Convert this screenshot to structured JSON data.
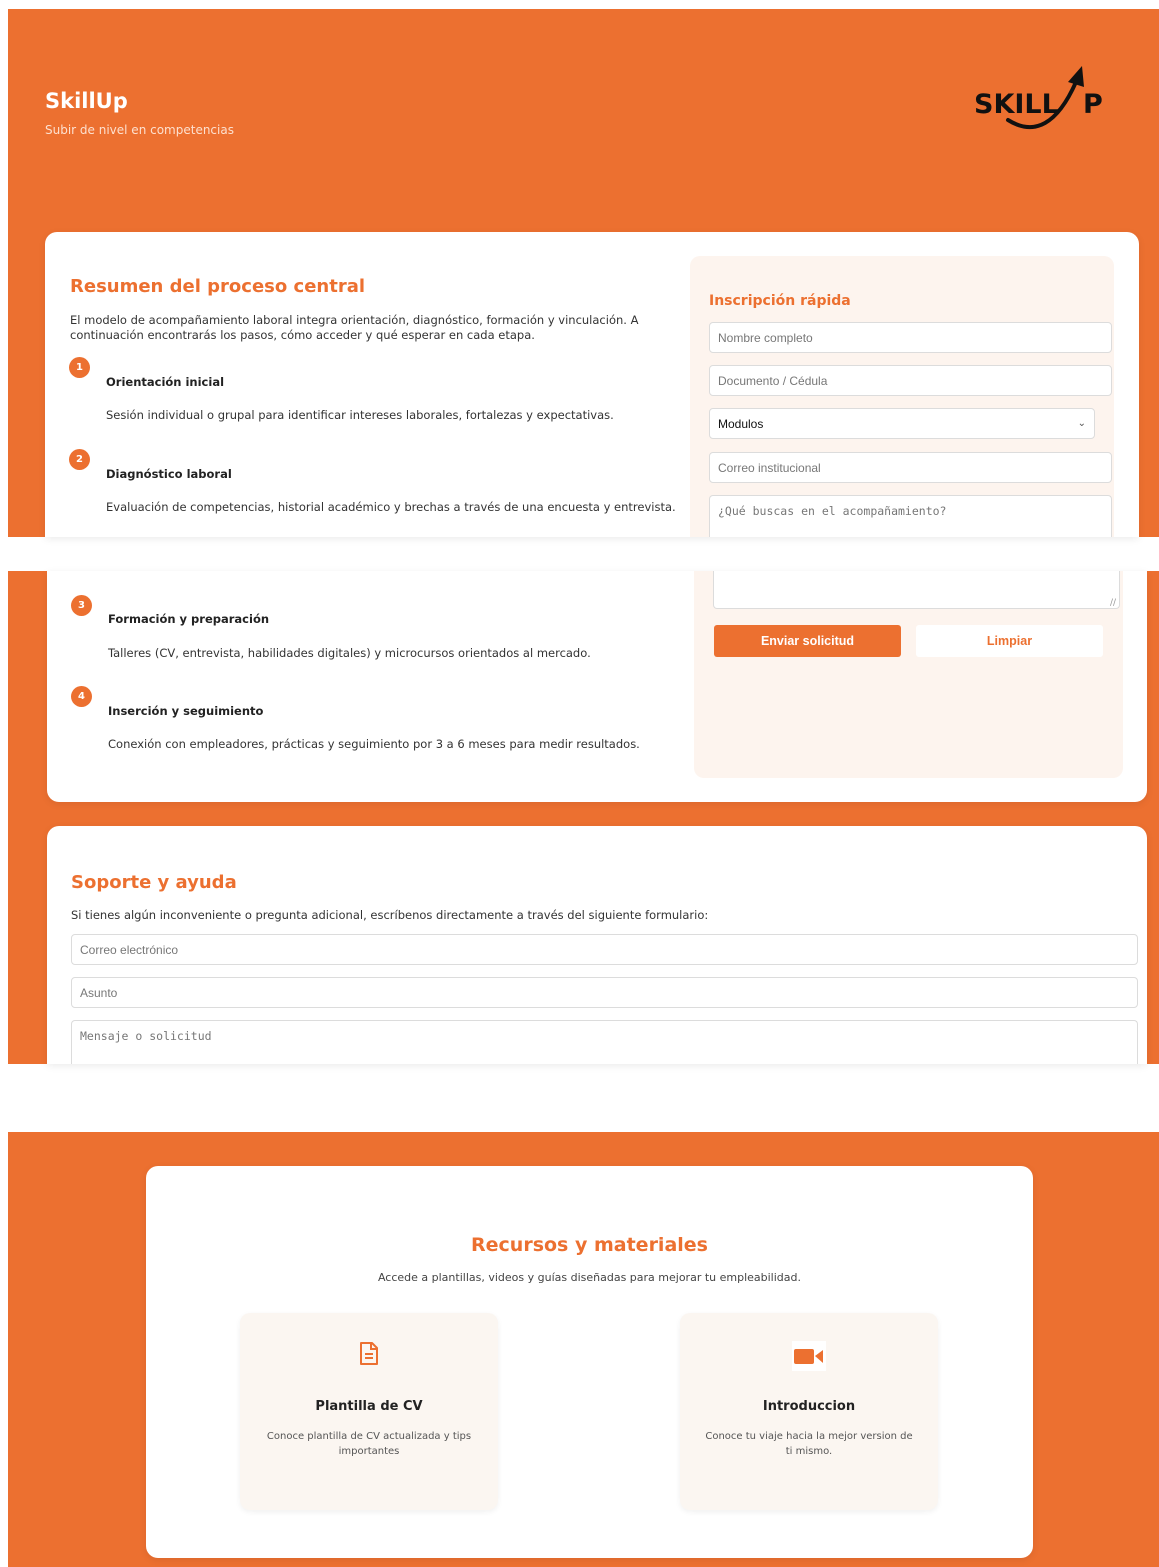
{
  "header": {
    "title": "SkillUp",
    "subtitle": "Subir de nivel en competencias",
    "logo_text_left": "SKILL",
    "logo_text_right": "P"
  },
  "process": {
    "title": "Resumen del proceso central",
    "intro_line1": "El modelo de acompañamiento laboral integra orientación, diagnóstico, formación y vinculación. A",
    "intro_line2": "continuación encontrarás los pasos, cómo acceder y qué esperar en cada etapa.",
    "steps": [
      {
        "num": "1",
        "title": "Orientación inicial",
        "desc": "Sesión individual o grupal para identificar intereses laborales, fortalezas y expectativas."
      },
      {
        "num": "2",
        "title": "Diagnóstico laboral",
        "desc": "Evaluación de competencias, historial académico y brechas a través de una encuesta y entrevista."
      },
      {
        "num": "3",
        "title": "Formación y preparación",
        "desc": "Talleres (CV, entrevista, habilidades digitales) y microcursos orientados al mercado."
      },
      {
        "num": "4",
        "title": "Inserción y seguimiento",
        "desc": "Conexión con empleadores, prácticas y seguimiento por 3 a 6 meses para medir resultados."
      }
    ]
  },
  "quick_form": {
    "title": "Inscripción rápida",
    "name_placeholder": "Nombre completo",
    "document_placeholder": "Documento / Cédula",
    "module_selected": "Modulos",
    "email_placeholder": "Correo institucional",
    "message_placeholder": "¿Qué buscas en el acompañamiento?",
    "submit_label": "Enviar solicitud",
    "clear_label": "Limpiar"
  },
  "support": {
    "title": "Soporte y ayuda",
    "intro": "Si tienes algún inconveniente o pregunta adicional, escríbenos directamente a través del siguiente formulario:",
    "email_placeholder": "Correo electrónico",
    "subject_placeholder": "Asunto",
    "message_placeholder": "Mensaje o solicitud"
  },
  "resources": {
    "title": "Recursos y materiales",
    "subtitle": "Accede a plantillas, videos y guías diseñadas para mejorar tu empleabilidad.",
    "cards": [
      {
        "icon": "document-icon",
        "title": "Plantilla de CV",
        "desc": "Conoce plantilla de CV actualizada y tips importantes"
      },
      {
        "icon": "video-camera-icon",
        "title": "Introduccion",
        "desc": "Conoce tu viaje hacia la mejor version de ti mismo."
      }
    ]
  },
  "colors": {
    "accent": "#EC7030",
    "panel": "#FDF4EE",
    "card": "#FBF6F1"
  }
}
